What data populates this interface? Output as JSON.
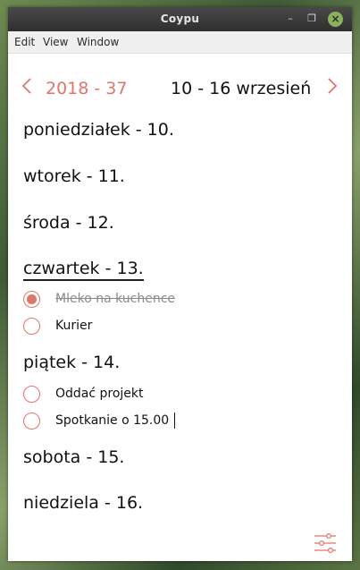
{
  "window": {
    "title": "Coypu"
  },
  "menu": {
    "items": [
      "Edit",
      "View",
      "Window"
    ]
  },
  "nav": {
    "prev_icon": "chevron-left-icon",
    "next_icon": "chevron-right-icon",
    "week": "2018 - 37",
    "range": "10 - 16 wrzesień"
  },
  "days": [
    {
      "label": "poniedziałek - 10.",
      "active": false,
      "tasks": []
    },
    {
      "label": "wtorek - 11.",
      "active": false,
      "tasks": []
    },
    {
      "label": "środa - 12.",
      "active": false,
      "tasks": []
    },
    {
      "label": "czwartek - 13.",
      "active": true,
      "tasks": [
        {
          "text": "Mleko na kuchence",
          "done": true
        },
        {
          "text": "Kurier",
          "done": false
        }
      ]
    },
    {
      "label": "piątek - 14.",
      "active": false,
      "tasks": [
        {
          "text": "Oddać projekt",
          "done": false
        },
        {
          "text": "Spotkanie o 15.00",
          "done": false,
          "editing": true
        }
      ]
    },
    {
      "label": "sobota - 15.",
      "active": false,
      "tasks": []
    },
    {
      "label": "niedziela - 16.",
      "active": false,
      "tasks": []
    }
  ],
  "colors": {
    "accent": "#e0766a",
    "text": "#111111",
    "done_text": "#8a8a8a"
  },
  "icons": {
    "settings": "sliders-icon",
    "close": "close-icon"
  }
}
